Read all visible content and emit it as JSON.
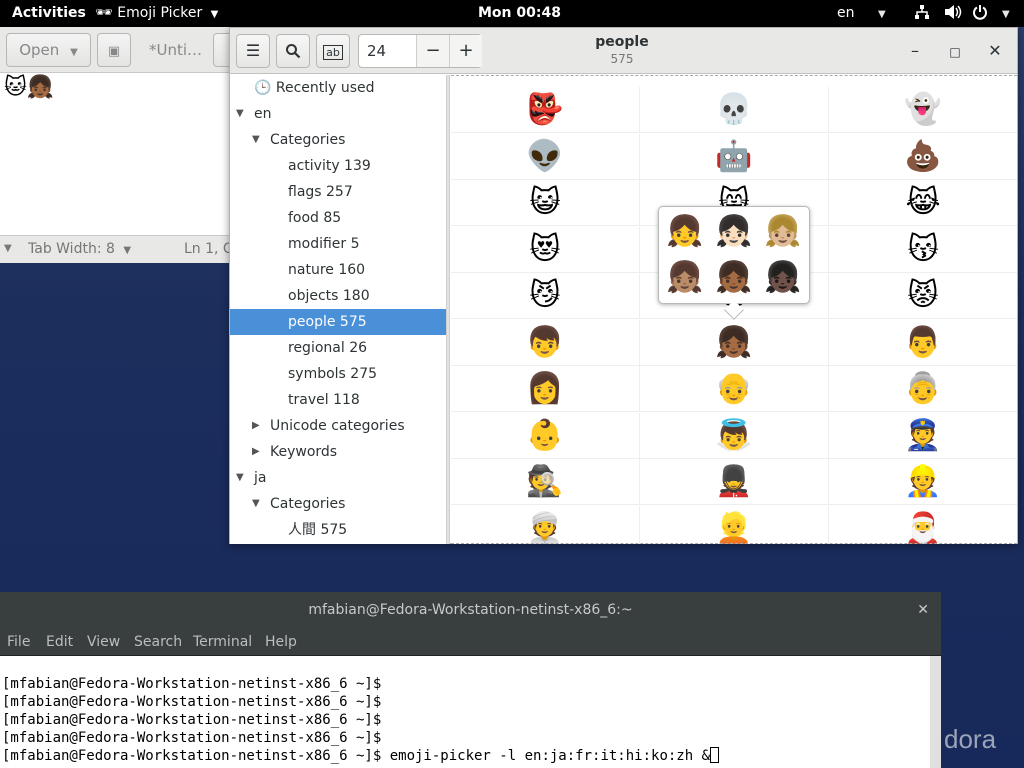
{
  "topbar": {
    "activities": "Activities",
    "app_name": "Emoji Picker",
    "clock": "Mon 00:48",
    "language": "en"
  },
  "editor": {
    "open_label": "Open",
    "tab_title": "*Unti…",
    "emojis": "🐱👧🏾",
    "tab_width": "Tab Width: 8",
    "position": "Ln 1, C"
  },
  "picker": {
    "font_size": "24",
    "title": "people",
    "subtitle": "575",
    "tree": [
      {
        "label": "🕒 Recently used",
        "indent": 0,
        "arrow": ""
      },
      {
        "label": "en",
        "indent": 0,
        "arrow": "down"
      },
      {
        "label": "Categories",
        "indent": 1,
        "arrow": "down"
      },
      {
        "label": "activity 139",
        "indent": 2,
        "arrow": ""
      },
      {
        "label": "flags 257",
        "indent": 2,
        "arrow": ""
      },
      {
        "label": "food 85",
        "indent": 2,
        "arrow": ""
      },
      {
        "label": "modifier 5",
        "indent": 2,
        "arrow": ""
      },
      {
        "label": "nature 160",
        "indent": 2,
        "arrow": ""
      },
      {
        "label": "objects 180",
        "indent": 2,
        "arrow": ""
      },
      {
        "label": "people 575",
        "indent": 2,
        "arrow": "",
        "selected": true
      },
      {
        "label": "regional 26",
        "indent": 2,
        "arrow": ""
      },
      {
        "label": "symbols 275",
        "indent": 2,
        "arrow": ""
      },
      {
        "label": "travel 118",
        "indent": 2,
        "arrow": ""
      },
      {
        "label": "Unicode categories",
        "indent": 1,
        "arrow": "right"
      },
      {
        "label": "Keywords",
        "indent": 1,
        "arrow": "right"
      },
      {
        "label": "ja",
        "indent": 0,
        "arrow": "down"
      },
      {
        "label": "Categories",
        "indent": 1,
        "arrow": "down"
      },
      {
        "label": "人間 575",
        "indent": 2,
        "arrow": ""
      }
    ],
    "grid": [
      [
        "👺",
        "💀",
        "👻"
      ],
      [
        "👽",
        "🤖",
        "💩"
      ],
      [
        "😺",
        "😸",
        "😹"
      ],
      [
        "😻",
        "😼",
        "😽"
      ],
      [
        "😼",
        "🙀",
        "😾"
      ],
      [
        "👦",
        "👧🏾",
        "👨"
      ],
      [
        "👩",
        "👴",
        "👵"
      ],
      [
        "👶",
        "👼",
        "👮"
      ],
      [
        "🕵",
        "💂",
        "👷"
      ],
      [
        "👳",
        "👱",
        "🎅"
      ]
    ],
    "popover": [
      [
        "👧",
        "👧🏻",
        "👧🏼"
      ],
      [
        "👧🏽",
        "👧🏾",
        "👧🏿"
      ]
    ]
  },
  "terminal": {
    "title": "mfabian@Fedora-Workstation-netinst-x86_6:~",
    "menu": [
      "File",
      "Edit",
      "View",
      "Search",
      "Terminal",
      "Help"
    ],
    "lines": [
      "[mfabian@Fedora-Workstation-netinst-x86_6 ~]$",
      "[mfabian@Fedora-Workstation-netinst-x86_6 ~]$",
      "[mfabian@Fedora-Workstation-netinst-x86_6 ~]$",
      "[mfabian@Fedora-Workstation-netinst-x86_6 ~]$",
      "[mfabian@Fedora-Workstation-netinst-x86_6 ~]$ emoji-picker -l en:ja:fr:it:hi:ko:zh &"
    ]
  },
  "desktop": {
    "watermark": "dora"
  }
}
